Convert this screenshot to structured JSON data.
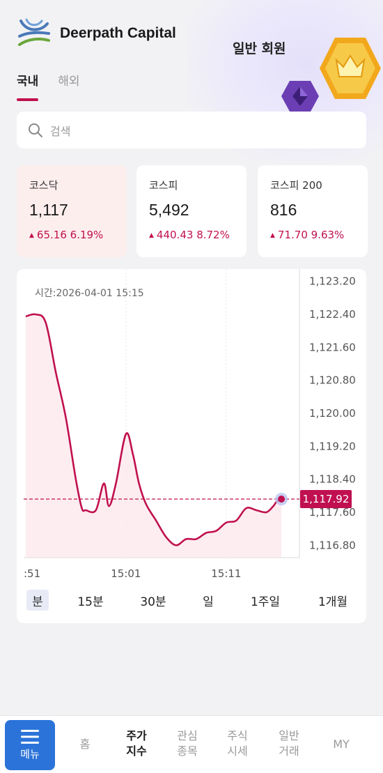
{
  "header": {
    "brand": "Deerpath Capital",
    "member_badge": "일반 회원"
  },
  "tabs": [
    {
      "label": "국내",
      "active": true
    },
    {
      "label": "해외",
      "active": false
    }
  ],
  "search": {
    "placeholder": "검색"
  },
  "cards": [
    {
      "name": "코스닥",
      "value": "1,117",
      "change": "65.16",
      "percent": "6.19%",
      "selected": true
    },
    {
      "name": "코스피",
      "value": "5,492",
      "change": "440.43",
      "percent": "8.72%",
      "selected": false
    },
    {
      "name": "코스피 200",
      "value": "816",
      "change": "71.70",
      "percent": "9.63%",
      "selected": false
    }
  ],
  "chart": {
    "timestamp": "시간:2026-04-01 15:15",
    "current_label": "1,117.92",
    "accent": "#c0104f",
    "fill": "#fde8ec"
  },
  "chart_data": {
    "type": "area",
    "ylim": [
      1116.5,
      1123.5
    ],
    "y_ticks": [
      "1,123.20",
      "1,122.40",
      "1,121.60",
      "1,120.80",
      "1,120.00",
      "1,119.20",
      "1,118.40",
      "1,117.60",
      "1,116.80"
    ],
    "y_tick_values": [
      1123.2,
      1122.4,
      1121.6,
      1120.8,
      1120.0,
      1119.2,
      1118.4,
      1117.6,
      1116.8
    ],
    "x_ticks": [
      ":51",
      "15:01",
      "15:11"
    ],
    "x_tick_values": [
      0,
      10,
      20
    ],
    "xlim": [
      -0.2,
      27.3
    ],
    "x": [
      0,
      1,
      2,
      3,
      4,
      5,
      5.6,
      6,
      7,
      7.8,
      8.3,
      9,
      10,
      10.7,
      11.3,
      12,
      13,
      14,
      15,
      16,
      17,
      18,
      19,
      20,
      21,
      22,
      23,
      24,
      24.7,
      25,
      25.5
    ],
    "y": [
      1122.35,
      1122.4,
      1122.2,
      1121.0,
      1119.9,
      1118.4,
      1117.7,
      1117.65,
      1117.65,
      1118.3,
      1117.75,
      1118.3,
      1119.5,
      1119.0,
      1118.3,
      1117.8,
      1117.4,
      1117.0,
      1116.8,
      1116.95,
      1116.95,
      1117.1,
      1117.15,
      1117.35,
      1117.4,
      1117.7,
      1117.65,
      1117.6,
      1117.75,
      1117.85,
      1117.92
    ],
    "current_value": 1117.92
  },
  "ranges": [
    {
      "label": "분",
      "active": true
    },
    {
      "label": "15분",
      "active": false
    },
    {
      "label": "30분",
      "active": false
    },
    {
      "label": "일",
      "active": false
    },
    {
      "label": "1주일",
      "active": false
    },
    {
      "label": "1개월",
      "active": false
    }
  ],
  "bottom_nav": {
    "menu_label": "메뉴",
    "items": [
      {
        "line1": "홈",
        "line2": "",
        "active": false
      },
      {
        "line1": "주가",
        "line2": "지수",
        "active": true
      },
      {
        "line1": "관심",
        "line2": "종목",
        "active": false
      },
      {
        "line1": "주식",
        "line2": "시세",
        "active": false
      },
      {
        "line1": "일반",
        "line2": "거래",
        "active": false
      },
      {
        "line1": "MY",
        "line2": "",
        "active": false
      }
    ]
  }
}
